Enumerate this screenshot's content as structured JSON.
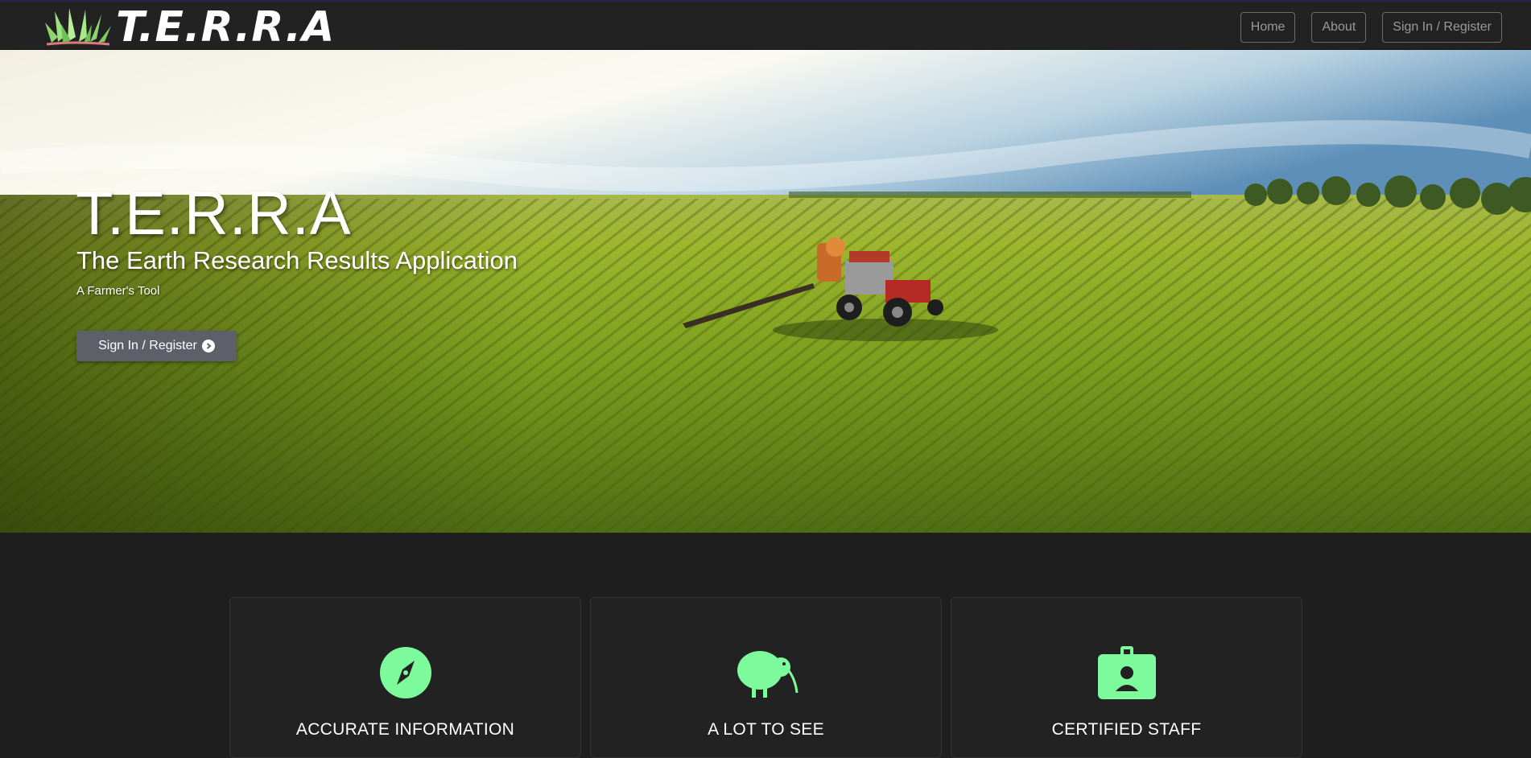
{
  "nav": {
    "brand": "T.E.R.R.A",
    "links": [
      "Home",
      "About",
      "Sign In / Register"
    ]
  },
  "hero": {
    "title": "T.E.R.R.A",
    "subtitle": "The Earth Research Results Application",
    "tagline": "A Farmer's Tool",
    "button_label": "Sign In / Register"
  },
  "features": [
    {
      "title": "ACCURATE INFORMATION",
      "icon": "compass-icon"
    },
    {
      "title": "A LOT TO SEE",
      "icon": "kiwi-bird-icon"
    },
    {
      "title": "CERTIFIED STAFF",
      "icon": "id-badge-icon"
    }
  ],
  "colors": {
    "accent_green": "#7dfa9c",
    "navbar_bg": "#222222",
    "page_bg": "#1f1f1f",
    "hero_button_bg": "#5d6068"
  }
}
